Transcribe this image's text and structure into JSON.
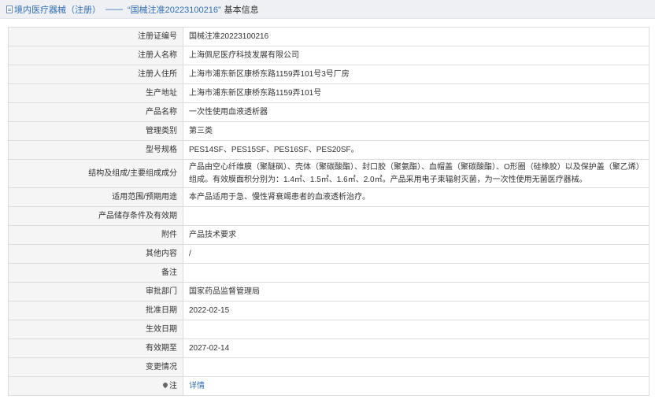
{
  "header": {
    "category": "境内医疗器械（注册）",
    "separator": "——",
    "record_title": "“国械注准20223100216”",
    "suffix": "基本信息"
  },
  "rows": [
    {
      "label": "注册证编号",
      "value": "国械注准20223100216"
    },
    {
      "label": "注册人名称",
      "value": "上海佩尼医疗科技发展有限公司"
    },
    {
      "label": "注册人住所",
      "value": "上海市浦东新区康桥东路1159弄101号3号厂房"
    },
    {
      "label": "生产地址",
      "value": "上海市浦东新区康桥东路1159弄101号"
    },
    {
      "label": "产品名称",
      "value": "一次性使用血液透析器"
    },
    {
      "label": "管理类别",
      "value": "第三类"
    },
    {
      "label": "型号规格",
      "value": "PES14SF、PES15SF、PES16SF、PES20SF。"
    },
    {
      "label": "结构及组成/主要组成成分",
      "value": "产品由空心纤维膜（聚醚砜）、壳体（聚碳酸酯）、封口胶（聚氨酯）、血帽盖（聚碳酸酯）、O形圈（硅橡胶）以及保护盖（聚乙烯）组成。有效膜面积分别为：1.4㎡、1.5㎡、1.6㎡、2.0㎡。产品采用电子束辐射灭菌，为一次性使用无菌医疗器械。"
    },
    {
      "label": "适用范围/预期用途",
      "value": "本产品适用于急、慢性肾衰竭患者的血液透析治疗。"
    },
    {
      "label": "产品储存条件及有效期",
      "value": ""
    },
    {
      "label": "附件",
      "value": "产品技术要求"
    },
    {
      "label": "其他内容",
      "value": "/"
    },
    {
      "label": "备注",
      "value": ""
    },
    {
      "label": "审批部门",
      "value": "国家药品监督管理局"
    },
    {
      "label": "批准日期",
      "value": "2022-02-15"
    },
    {
      "label": "生效日期",
      "value": ""
    },
    {
      "label": "有效期至",
      "value": "2027-02-14"
    },
    {
      "label": "变更情况",
      "value": ""
    }
  ],
  "note": {
    "label": "注",
    "link_text": "详情",
    "icon": "pin-icon"
  }
}
